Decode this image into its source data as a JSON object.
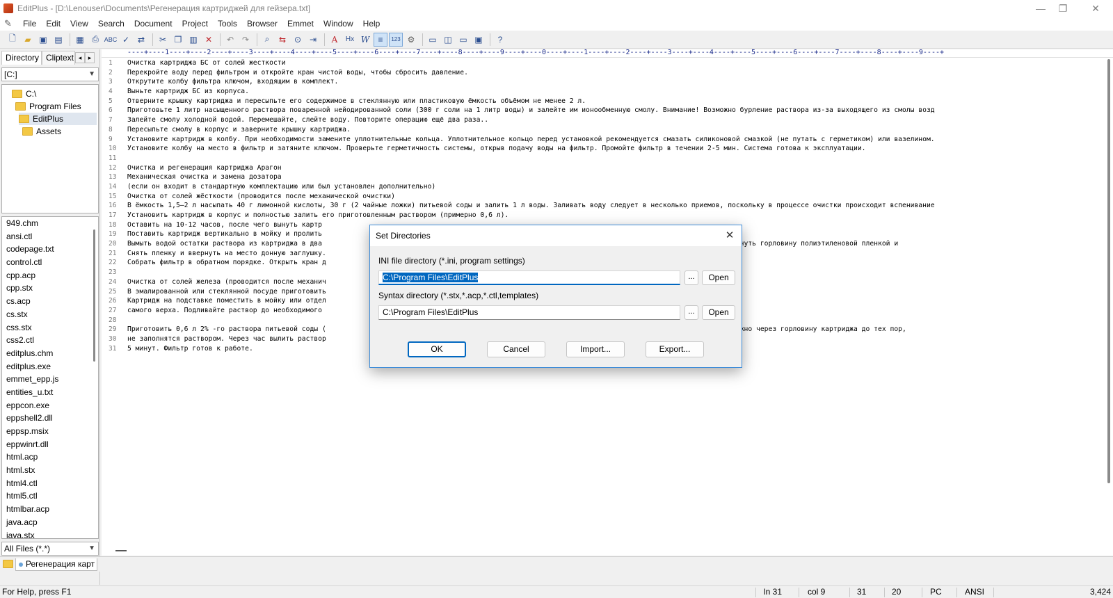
{
  "window": {
    "title": "EditPlus - [D:\\Lenouser\\Documents\\Регенерация картриджей для гейзера.txt]",
    "controls": [
      "—",
      "❐",
      "✕"
    ]
  },
  "menubar": {
    "items": [
      "File",
      "Edit",
      "View",
      "Search",
      "Document",
      "Project",
      "Tools",
      "Browser",
      "Emmet",
      "Window",
      "Help"
    ],
    "mdi_controls": [
      "–",
      "❐",
      "✕"
    ]
  },
  "toolbar": {
    "icons": [
      "new-file-icon",
      "open-icon",
      "save-icon",
      "save-all-icon",
      "print-preview-icon",
      "print-icon",
      "spell-check-icon",
      "check-icon",
      "ftp-icon",
      "cut-icon",
      "copy-icon",
      "paste-icon",
      "delete-icon",
      "undo-icon",
      "redo-icon",
      "find-icon",
      "replace-icon",
      "find-in-files-icon",
      "go-to-icon",
      "font-icon",
      "hex-icon",
      "word-wrap-icon",
      "line-number-icon",
      "column-ruler-icon",
      "settings-icon",
      "screen-1-icon",
      "screen-2-icon",
      "screen-3-icon",
      "screen-4-icon",
      "help-icon"
    ]
  },
  "left_panel": {
    "tabs": [
      "Directory",
      "Cliptext"
    ],
    "drive": "[C:]",
    "tree": [
      "C:\\",
      "Program Files",
      "EditPlus",
      "Assets"
    ],
    "files": [
      "949.chm",
      "ansi.ctl",
      "codepage.txt",
      "control.ctl",
      "cpp.acp",
      "cpp.stx",
      "cs.acp",
      "cs.stx",
      "css.stx",
      "css2.ctl",
      "editplus.chm",
      "editplus.exe",
      "emmet_epp.js",
      "entities_u.txt",
      "eppcon.exe",
      "eppshell2.dll",
      "eppsp.msix",
      "eppwinrt.dll",
      "html.acp",
      "html.stx",
      "html4.ctl",
      "html5.ctl",
      "htmlbar.acp",
      "java.acp",
      "java.stx"
    ],
    "filter": "All Files (*.*)"
  },
  "editor": {
    "ruler": "----+----1----+----2----+----3----+----4----+----5----+----6----+----7----+----8----+----9----+----0----+----1----+----2----+----3----+----4----+----5----+----6----+----7----+----8----+----9----+",
    "lines": [
      "Очистка картриджа БС от солей жесткости",
      "Перекройте воду перед фильтром и откройте кран чистой воды, чтобы сбросить давление.",
      "Открутите колбу фильтра ключом, входящим в комплект.",
      "Выньте картридж БС из корпуса.",
      "Отверните крышку картриджа и пересыпьте его содержимое в стеклянную или пластиковую ёмкость объёмом не менее 2 л.",
      "Приготовьте 1 литр насыщенного раствора поваренной нейодированной соли (300 г соли на 1 литр воды) и залейте им ионообменную смолу. Внимание! Возможно бурление раствора из-за выходящего из смолы возд",
      "Залейте смолу холодной водой. Перемешайте, слейте воду. Повторите операцию ещё два раза..",
      "Пересыпьте смолу в корпус и заверните крышку картриджа.",
      "Установите картридж в колбу. При необходимости замените уплотнительные кольца. Уплотнительное кольцо перед установкой рекомендуется смазать силиконовой смазкой (не путать с герметиком) или вазелином.",
      "Установите колбу на место в фильтр и затяните ключом. Проверьте герметичность системы, открыв подачу воды на фильтр. Промойте фильтр в течении 2-5 мин. Система готова к эксплуатации.",
      "",
      "Очистка и регенерация картриджа Арагон",
      "Механическая очистка и замена дозатора",
      "(если он входит в стандартную комплектацию или был установлен дополнительно)",
      "Очистка от солей жёсткости (проводится после механической очистки)",
      "В ёмкость 1,5–2 л насыпать 40 г лимонной кислоты, 30 г (2 чайные ложки) питьевой соды и залить 1 л воды. Заливать воду следует в несколько приемов, поскольку в процессе очистки происходит вспенивание",
      "Установить картридж в корпус и полностью залить его приготовленным раствором (примерно 0,6 л).",
      "Оставить на 10-12 часов, после чего вынуть картр",
      "Поставить картридж вертикально в мойку и пролить                                                                       ть полностью стечь.",
      "Вымыть водой остатки раствора из картриджа в два                                                                        резьбовую горловину. Затем обернуть горловину полиэтиленовой пленкой и",
      "Снять пленку и ввернуть на место донную заглушку.",
      "Собрать фильтр в обратном порядке. Открыть кран д                                                                       н.",
      "",
      "Очистка от солей железа (проводится после механич",
      "В эмалированной или стеклянной посуде приготовить                                                                        на литр воды).",
      "Картридж на подставке поместить в мойку или отдел                                                                        горловину) до",
      "самого верха. Подливайте раствор до необходимого                                                                        прозрачной.",
      "",
      "Приготовить 0,6 л 2% -го раствора питьевой соды (                                                                       створ соды. Заливать раствор нужно через горловину картриджа до тех пор,",
      "не заполнятся раствором. Через час вылить раствор                                                                        в течение",
      "5 минут. Фильтр готов к работе."
    ]
  },
  "doc_tabs": {
    "active": "Регенерация карт"
  },
  "statusbar": {
    "help": "For Help, press F1",
    "line": "ln 31",
    "col": "col 9",
    "total_lines": "31",
    "f4": "20",
    "eol": "PC",
    "encoding": "ANSI",
    "size": "3,424"
  },
  "dialog": {
    "title": "Set Directories",
    "ini_label": "INI file directory (*.ini, program settings)",
    "ini_value": "C:\\Program Files\\EditPlus",
    "syntax_label": "Syntax directory (*.stx,*.acp,*.ctl,templates)",
    "syntax_value": "C:\\Program Files\\EditPlus",
    "browse_label": "...",
    "open_label": "Open",
    "ok_label": "OK",
    "cancel_label": "Cancel",
    "import_label": "Import...",
    "export_label": "Export..."
  }
}
